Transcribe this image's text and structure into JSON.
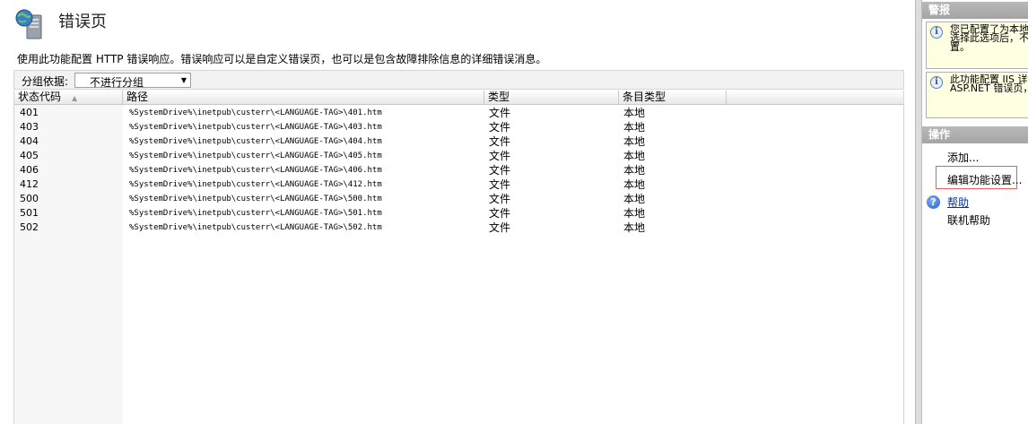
{
  "main": {
    "title": "错误页",
    "description": "使用此功能配置 HTTP 错误响应。错误响应可以是自定义错误页，也可以是包含故障排除信息的详细错误消息。",
    "group_by_label": "分组依据:",
    "group_by_value": "不进行分组",
    "columns": [
      "状态代码",
      "路径",
      "类型",
      "条目类型"
    ],
    "rows": [
      [
        "401",
        "%SystemDrive%\\inetpub\\custerr\\<LANGUAGE-TAG>\\401.htm",
        "文件",
        "本地"
      ],
      [
        "403",
        "%SystemDrive%\\inetpub\\custerr\\<LANGUAGE-TAG>\\403.htm",
        "文件",
        "本地"
      ],
      [
        "404",
        "%SystemDrive%\\inetpub\\custerr\\<LANGUAGE-TAG>\\404.htm",
        "文件",
        "本地"
      ],
      [
        "405",
        "%SystemDrive%\\inetpub\\custerr\\<LANGUAGE-TAG>\\405.htm",
        "文件",
        "本地"
      ],
      [
        "406",
        "%SystemDrive%\\inetpub\\custerr\\<LANGUAGE-TAG>\\406.htm",
        "文件",
        "本地"
      ],
      [
        "412",
        "%SystemDrive%\\inetpub\\custerr\\<LANGUAGE-TAG>\\412.htm",
        "文件",
        "本地"
      ],
      [
        "500",
        "%SystemDrive%\\inetpub\\custerr\\<LANGUAGE-TAG>\\500.htm",
        "文件",
        "本地"
      ],
      [
        "501",
        "%SystemDrive%\\inetpub\\custerr\\<LANGUAGE-TAG>\\501.htm",
        "文件",
        "本地"
      ],
      [
        "502",
        "%SystemDrive%\\inetpub\\custerr\\<LANGUAGE-TAG>\\502.htm",
        "文件",
        "本地"
      ]
    ]
  },
  "actions": {
    "alerts_header": "警报",
    "alert1_text": "您已配置了为本地请求返回的详细错误。选择此选项后，不会返回自定义的错误配置。",
    "alert2_text": "此功能配置 IIS 详细了解如何配置 ASP.NET 错误页，处。",
    "actions_header": "操作",
    "add": "添加...",
    "edit_settings": "编辑功能设置...",
    "help": "帮助",
    "online_help": "联机帮助"
  },
  "icons": {
    "title_icon": "server-globe-icon",
    "alert_icon": "info-icon",
    "help_icon": "help-icon",
    "sort_icon": "sort-ascending-icon",
    "dropdown_icon": "dropdown-arrow-icon"
  },
  "colors": {
    "header_gray": "#a4a4a4",
    "alert_yellow": "#ffffe1",
    "highlight_frame": "#e06060",
    "link_blue": "#0033aa"
  }
}
